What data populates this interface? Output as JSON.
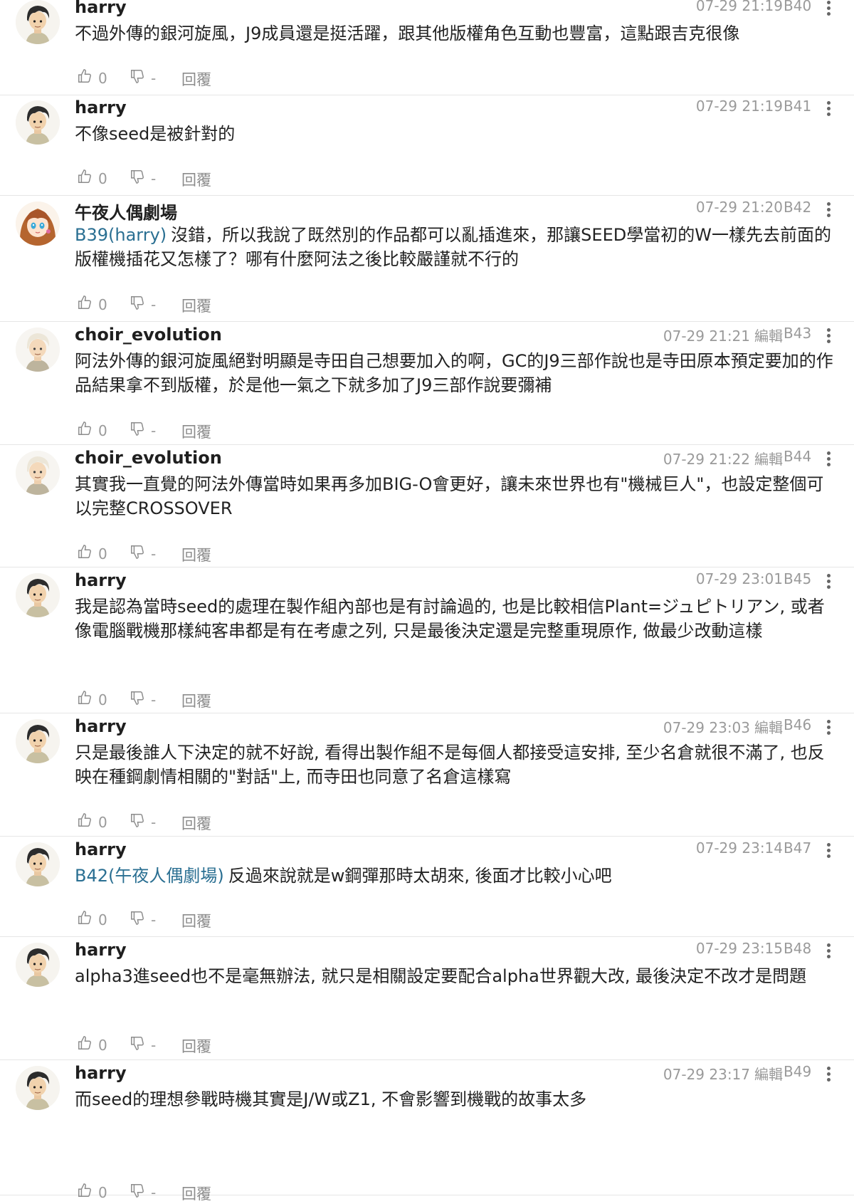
{
  "ui": {
    "reply_label": "回覆"
  },
  "comments": [
    {
      "user": "harry",
      "avatar": "harry-avatar",
      "time": "07-29 21:19",
      "edited": "",
      "floor": "B40",
      "reply_to": "",
      "text": "不過外傳的銀河旋風，J9成員還是挺活躍，跟其他版權角色互動也豐富，這點跟吉克很像",
      "likes": "0",
      "dislikes": "-"
    },
    {
      "user": "harry",
      "avatar": "harry-avatar",
      "time": "07-29 21:19",
      "edited": "",
      "floor": "B41",
      "reply_to": "",
      "text": "不像seed是被針對的",
      "likes": "0",
      "dislikes": "-"
    },
    {
      "user": "午夜人偶劇場",
      "avatar": "anime-girl-avatar",
      "time": "07-29 21:20",
      "edited": "",
      "floor": "B42",
      "reply_to": "B39(harry)",
      "text": "沒錯，所以我說了既然別的作品都可以亂插進來，那讓SEED學當初的W一樣先去前面的版權機插花又怎樣了？哪有什麼阿法之後比較嚴謹就不行的",
      "likes": "0",
      "dislikes": "-"
    },
    {
      "user": "choir_evolution",
      "avatar": "white-hair-avatar",
      "time": "07-29 21:21",
      "edited": "編輯",
      "floor": "B43",
      "reply_to": "",
      "text": "阿法外傳的銀河旋風絕對明顯是寺田自己想要加入的啊，GC的J9三部作說也是寺田原本預定要加的作品結果拿不到版權，於是他一氣之下就多加了J9三部作說要彌補",
      "likes": "0",
      "dislikes": "-"
    },
    {
      "user": "choir_evolution",
      "avatar": "white-hair-avatar",
      "time": "07-29 21:22",
      "edited": "編輯",
      "floor": "B44",
      "reply_to": "",
      "text": "其實我一直覺的阿法外傳當時如果再多加BIG-O會更好，讓未來世界也有\"機械巨人\"，也設定整個可以完整CROSSOVER",
      "likes": "0",
      "dislikes": "-"
    },
    {
      "user": "harry",
      "avatar": "harry-avatar",
      "time": "07-29 23:01",
      "edited": "",
      "floor": "B45",
      "reply_to": "",
      "text": "我是認為當時seed的處理在製作組內部也是有討論過的, 也是比較相信Plant=ジュピトリアン, 或者像電腦戰機那樣純客串都是有在考慮之列, 只是最後決定還是完整重現原作, 做最少改動這樣",
      "likes": "0",
      "dislikes": "-"
    },
    {
      "user": "harry",
      "avatar": "harry-avatar",
      "time": "07-29 23:03",
      "edited": "編輯",
      "floor": "B46",
      "reply_to": "",
      "text": "只是最後誰人下決定的就不好說, 看得出製作組不是每個人都接受這安排, 至少名倉就很不滿了, 也反映在種鋼劇情相關的\"對話\"上, 而寺田也同意了名倉這樣寫",
      "likes": "0",
      "dislikes": "-"
    },
    {
      "user": "harry",
      "avatar": "harry-avatar",
      "time": "07-29 23:14",
      "edited": "",
      "floor": "B47",
      "reply_to": "B42(午夜人偶劇場)",
      "text": "反過來說就是w鋼彈那時太胡來, 後面才比較小心吧",
      "likes": "0",
      "dislikes": "-"
    },
    {
      "user": "harry",
      "avatar": "harry-avatar",
      "time": "07-29 23:15",
      "edited": "",
      "floor": "B48",
      "reply_to": "",
      "text": "alpha3進seed也不是毫無辦法, 就只是相關設定要配合alpha世界觀大改, 最後決定不改才是問題",
      "likes": "0",
      "dislikes": "-"
    },
    {
      "user": "harry",
      "avatar": "harry-avatar",
      "time": "07-29 23:17",
      "edited": "編輯",
      "floor": "B49",
      "reply_to": "",
      "text": "而seed的理想參戰時機其實是J/W或Z1, 不會影響到機戰的故事太多",
      "likes": "0",
      "dislikes": "-"
    }
  ]
}
